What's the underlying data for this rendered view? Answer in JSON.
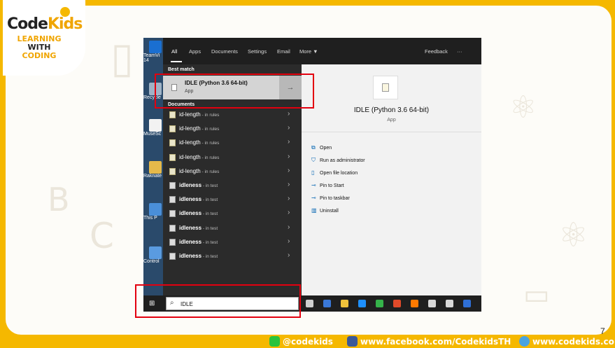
{
  "brand": {
    "logo_word_code": "Code",
    "logo_word_kids": "Kids",
    "tagline": [
      "LEARNING",
      "WITH",
      "CODING"
    ]
  },
  "desktop": {
    "items": [
      "TeamVi 14",
      "Recycle",
      "MuseSc",
      "Raknate",
      "This P",
      "Control"
    ]
  },
  "search_menu": {
    "tabs": [
      "All",
      "Apps",
      "Documents",
      "Settings",
      "Email",
      "More ▼"
    ],
    "feedback_label": "Feedback",
    "more_dots": "···",
    "best_match_heading": "Best match",
    "best_match": {
      "title": "IDLE (Python 3.6 64-bit)",
      "subtitle": "App",
      "arrow": "→"
    },
    "documents_heading": "Documents",
    "results": [
      {
        "name": "id-length",
        "meta": " - in rules",
        "type": "doc"
      },
      {
        "name": "id-length",
        "meta": " - in rules",
        "type": "doc"
      },
      {
        "name": "id-length",
        "meta": " - in rules",
        "type": "doc"
      },
      {
        "name": "id-length",
        "meta": " - in rules",
        "type": "doc"
      },
      {
        "name": "id-length",
        "meta": " - in rules",
        "type": "doc"
      },
      {
        "name": "idleness",
        "meta": " - in test",
        "type": "plain"
      },
      {
        "name": "idleness",
        "meta": " - in test",
        "type": "plain"
      },
      {
        "name": "idleness",
        "meta": " - in test",
        "type": "plain"
      },
      {
        "name": "idleness",
        "meta": " - in test",
        "type": "plain"
      },
      {
        "name": "idleness",
        "meta": " - in test",
        "type": "plain"
      },
      {
        "name": "idleness",
        "meta": " - in test",
        "type": "plain"
      }
    ],
    "detail": {
      "title": "IDLE (Python 3.6 64-bit)",
      "subtitle": "App",
      "actions": [
        {
          "label": "Open",
          "icon": "open-icon",
          "glyph": "⧉"
        },
        {
          "label": "Run as administrator",
          "icon": "shield-run-icon",
          "glyph": "⛉"
        },
        {
          "label": "Open file location",
          "icon": "folder-icon",
          "glyph": "▯"
        },
        {
          "label": "Pin to Start",
          "icon": "pin-icon",
          "glyph": "⊸"
        },
        {
          "label": "Pin to taskbar",
          "icon": "pin-icon",
          "glyph": "⊸"
        },
        {
          "label": "Uninstall",
          "icon": "trash-icon",
          "glyph": "▥"
        }
      ]
    }
  },
  "taskbar": {
    "search_value": "IDLE",
    "icon_colors": [
      "#cfcfcf",
      "#3a78d8",
      "#f0c23b",
      "#1e90ff",
      "#35b34a",
      "#e04a2a",
      "#ff7a00",
      "#d8d8d8",
      "#d8d8d8",
      "#2f6fd6"
    ]
  },
  "footer": {
    "line": "@codekids",
    "facebook": "www.facebook.com/CodekidsTH",
    "web": "www.codekids.co",
    "page_number": "7"
  },
  "colors": {
    "brand_yellow": "#f5b800",
    "highlight_red": "#e3000f",
    "line_green": "#29c33b",
    "fb_blue": "#3b5998"
  }
}
